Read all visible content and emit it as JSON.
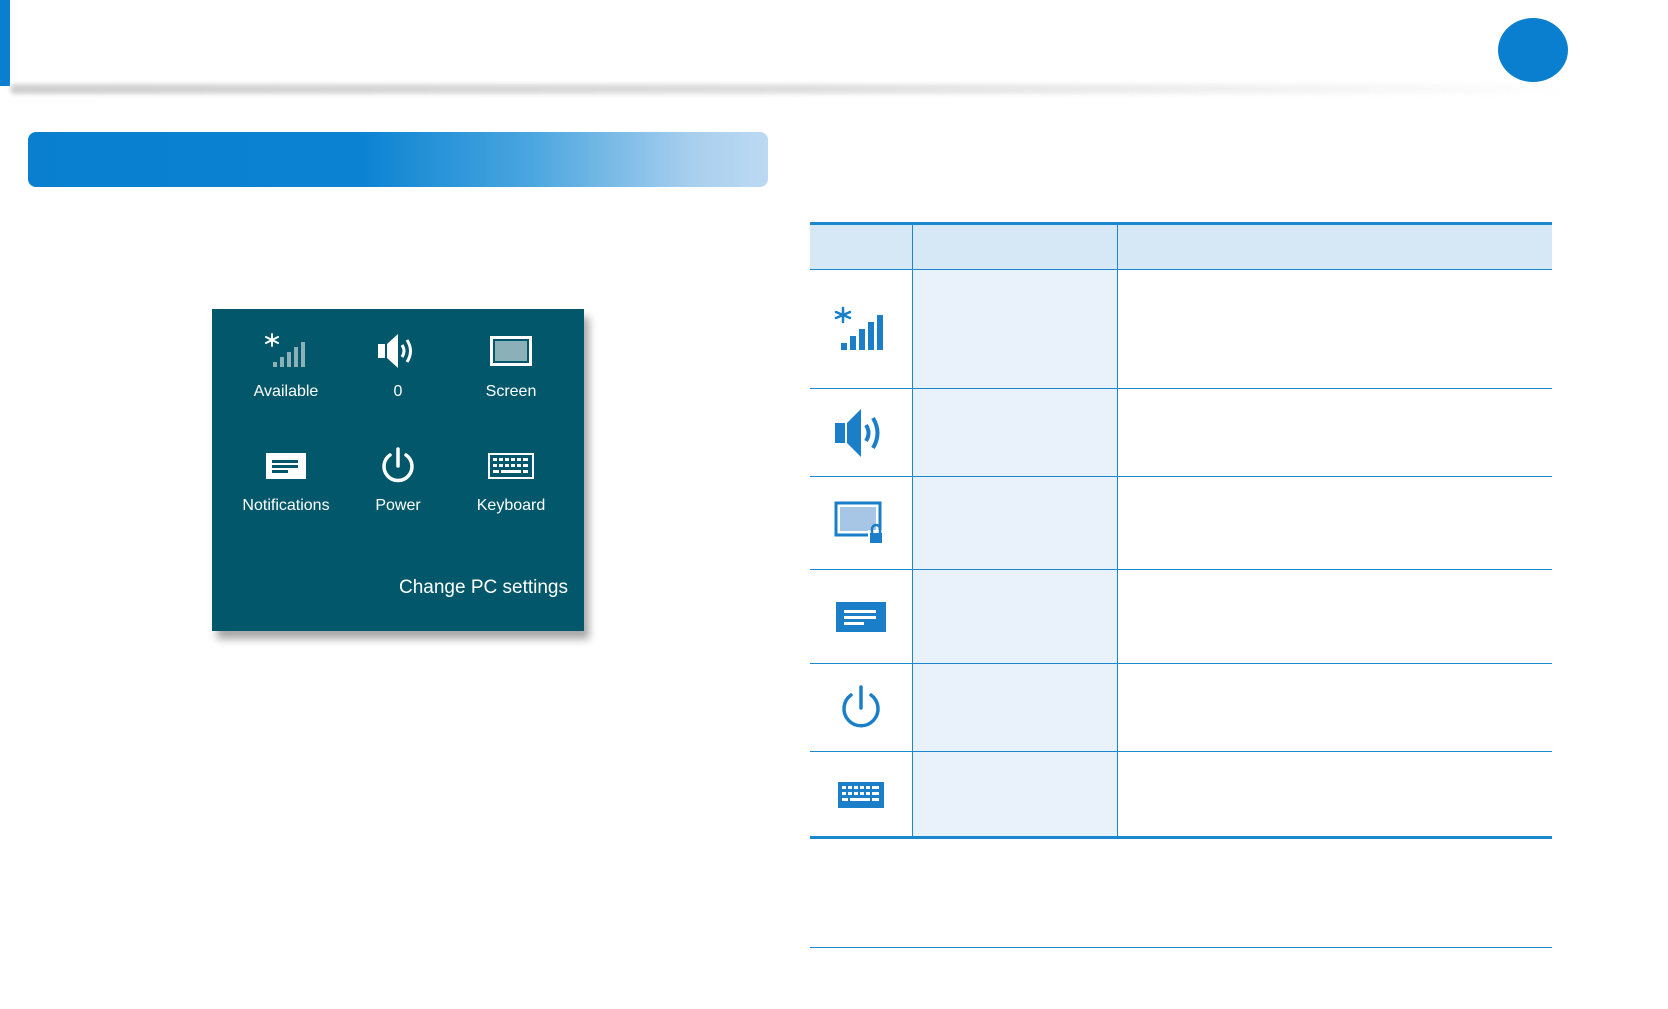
{
  "panel": {
    "tiles": [
      {
        "label": "Available",
        "icon": "network-signal-icon"
      },
      {
        "label": "0",
        "icon": "speaker-volume-icon"
      },
      {
        "label": "Screen",
        "icon": "screen-brightness-icon"
      },
      {
        "label": "Notifications",
        "icon": "notifications-icon"
      },
      {
        "label": "Power",
        "icon": "power-icon"
      },
      {
        "label": "Keyboard",
        "icon": "keyboard-icon"
      }
    ],
    "change_settings": "Change PC settings"
  },
  "table": {
    "rows": [
      {
        "icon": "network-signal-icon"
      },
      {
        "icon": "speaker-volume-icon"
      },
      {
        "icon": "screen-lock-icon"
      },
      {
        "icon": "notifications-icon"
      },
      {
        "icon": "power-icon"
      },
      {
        "icon": "keyboard-icon"
      }
    ]
  },
  "colors": {
    "accent": "#0a7fd0",
    "panel_bg": "#02586a",
    "table_rule": "#1a87cf",
    "table_header_bg": "#d6e8f6",
    "table_name_bg": "#e9f2fb",
    "icon_blue": "#1a7fc8"
  }
}
